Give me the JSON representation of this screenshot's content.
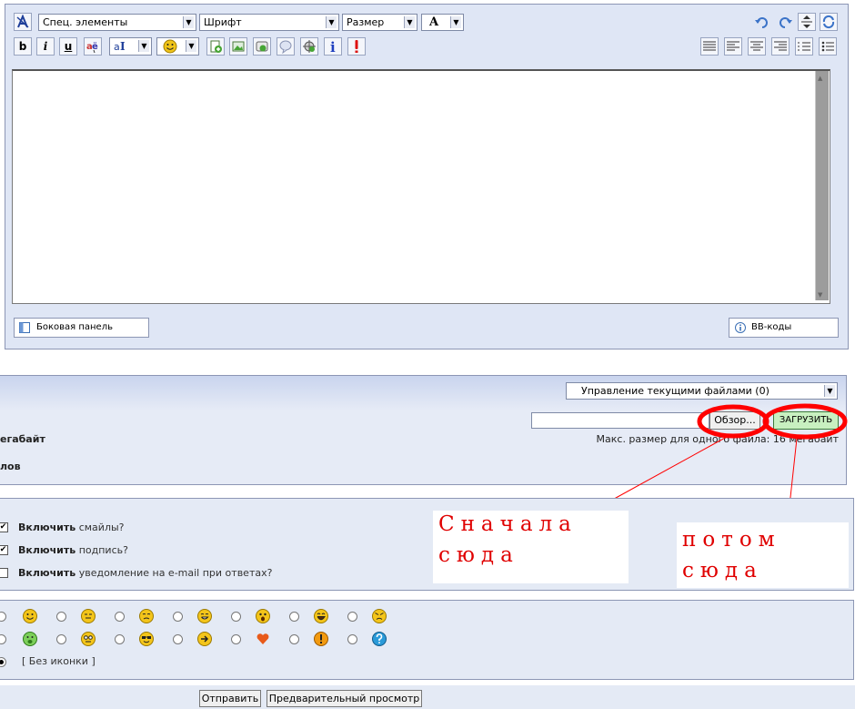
{
  "toolbar": {
    "special_elements": "Спец. элементы",
    "font": "Шрифт",
    "size": "Размер",
    "color_letter": "A",
    "bold": "b",
    "italic": "i",
    "underline": "u"
  },
  "editor": {
    "side_panel_button": "Боковая панель",
    "bbcodes_button": "BB-коды"
  },
  "files": {
    "manage_select": "Управление текущими файлами (0)",
    "browse_button": "Обзор...",
    "upload_button": "ЗАГРУЗИТЬ",
    "max_size_text": "Макс. размер для одного файла: 16 мегабайт",
    "left_cut_size": "егабайт",
    "left_cut_files": "лов"
  },
  "options": [
    {
      "strong": "Включить",
      "text": "смайлы?",
      "checked": true
    },
    {
      "strong": "Включить",
      "text": "подпись?",
      "checked": true
    },
    {
      "strong": "Включить",
      "text": "уведомление на e-mail при ответах?",
      "checked": false
    }
  ],
  "icons": {
    "no_icon_label": "[ Без иконки ]"
  },
  "buttons": {
    "send": "Отправить",
    "preview": "Предварительный просмотр"
  },
  "annotations": {
    "first_line1": "Сначала",
    "first_line2": "сюда",
    "then_line1": "потом",
    "then_line2": "сюда",
    "color": "#e00000"
  },
  "colors": {
    "panel": "#dfe6f5",
    "border": "#8c96b4"
  }
}
